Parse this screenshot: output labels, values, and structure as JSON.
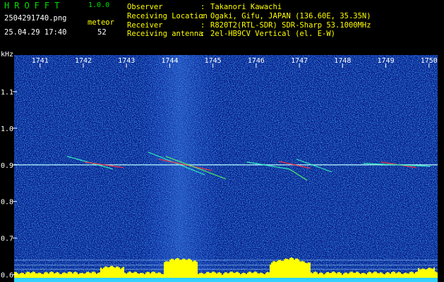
{
  "app": {
    "title": "HROFFT",
    "version": "1.0.0"
  },
  "file": {
    "name": "2504291740.png",
    "datetime": "25.04.29 17:40"
  },
  "meteor": {
    "label": "meteor",
    "count": "52"
  },
  "info": [
    {
      "label": "Observer",
      "value": "Takanori Kawachi"
    },
    {
      "label": "Receiving Location",
      "value": "Ogaki, Gifu, JAPAN (136.60E, 35.35N)"
    },
    {
      "label": "Receiver",
      "value": "R820T2(RTL-SDR) SDR-Sharp 53.1000MHz"
    },
    {
      "label": "Receiving antenna",
      "value": "2el-HB9CV Vertical (el. E-W)"
    }
  ],
  "colon": ":",
  "y_unit": "kHz",
  "colors": {
    "title": "#00e000",
    "info": "#ffff00",
    "axis": "#ffffff",
    "background": "#0a1a8c",
    "histogram": "#ffff00"
  },
  "chart_data": {
    "type": "heatmap",
    "x_ticks": [
      "1741",
      "1742",
      "1743",
      "1744",
      "1745",
      "1746",
      "1747",
      "1748",
      "1749",
      "1750"
    ],
    "y_ticks": [
      "1.1",
      "1.0",
      "0.9",
      "0.8",
      "0.7",
      "0.6"
    ],
    "y_values": [
      1.1,
      1.0,
      0.9,
      0.8,
      0.7,
      0.6
    ],
    "ylim": [
      0.58,
      1.2
    ],
    "xlim": [
      1740.4,
      1750.2
    ],
    "carrier_khz": 0.9
  }
}
